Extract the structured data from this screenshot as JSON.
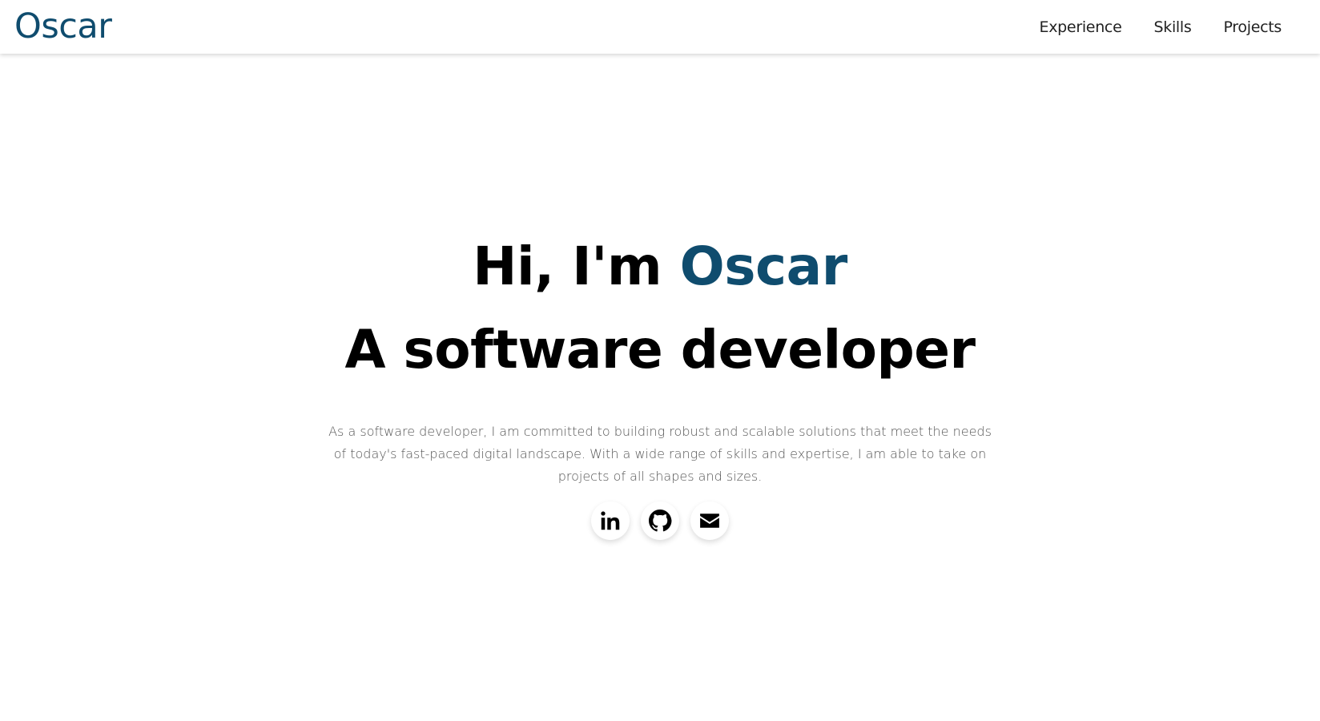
{
  "header": {
    "logo": "Oscar",
    "nav": [
      {
        "label": "Experience"
      },
      {
        "label": "Skills"
      },
      {
        "label": "Projects"
      }
    ]
  },
  "hero": {
    "greeting": "Hi, I'm ",
    "name": "Oscar",
    "role": "A software developer",
    "description": "As a software developer, I am committed to building robust and scalable solutions that meet the needs of today's fast-paced digital landscape. With a wide range of skills and expertise, I am able to take on projects of all shapes and sizes."
  },
  "social": [
    {
      "icon": "linkedin-icon"
    },
    {
      "icon": "github-icon"
    },
    {
      "icon": "mail-icon"
    }
  ],
  "colors": {
    "accent": "#0f4c6e",
    "text": "#000000",
    "muted": "#555555"
  }
}
